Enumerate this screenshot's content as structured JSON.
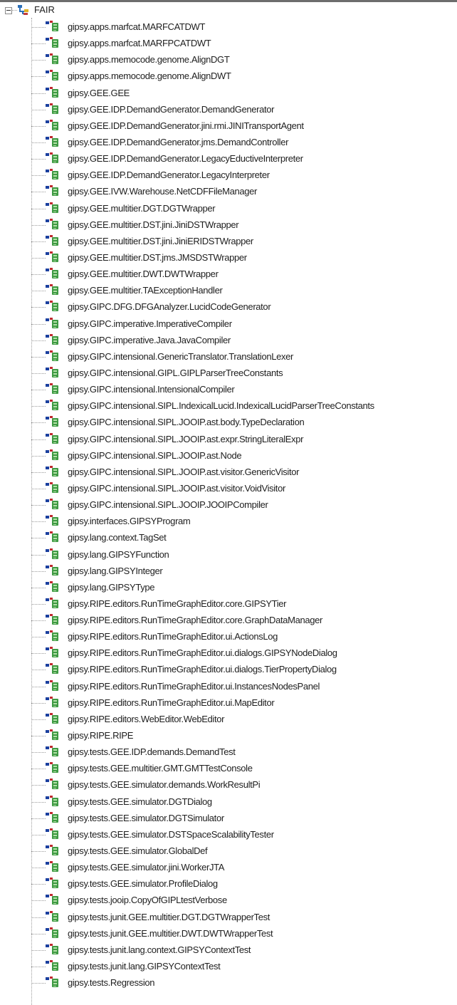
{
  "tree": {
    "root": {
      "label": "FAIR",
      "icon": "package-tree-icon",
      "expanded": true
    },
    "item_icon": "class-icon",
    "items": [
      "gipsy.apps.marfcat.MARFCATDWT",
      "gipsy.apps.marfcat.MARFPCATDWT",
      "gipsy.apps.memocode.genome.AlignDGT",
      "gipsy.apps.memocode.genome.AlignDWT",
      "gipsy.GEE.GEE",
      "gipsy.GEE.IDP.DemandGenerator.DemandGenerator",
      "gipsy.GEE.IDP.DemandGenerator.jini.rmi.JINITransportAgent",
      "gipsy.GEE.IDP.DemandGenerator.jms.DemandController",
      "gipsy.GEE.IDP.DemandGenerator.LegacyEductiveInterpreter",
      "gipsy.GEE.IDP.DemandGenerator.LegacyInterpreter",
      "gipsy.GEE.IVW.Warehouse.NetCDFFileManager",
      "gipsy.GEE.multitier.DGT.DGTWrapper",
      "gipsy.GEE.multitier.DST.jini.JiniDSTWrapper",
      "gipsy.GEE.multitier.DST.jini.JiniERIDSTWrapper",
      "gipsy.GEE.multitier.DST.jms.JMSDSTWrapper",
      "gipsy.GEE.multitier.DWT.DWTWrapper",
      "gipsy.GEE.multitier.TAExceptionHandler",
      "gipsy.GIPC.DFG.DFGAnalyzer.LucidCodeGenerator",
      "gipsy.GIPC.imperative.ImperativeCompiler",
      "gipsy.GIPC.imperative.Java.JavaCompiler",
      "gipsy.GIPC.intensional.GenericTranslator.TranslationLexer",
      "gipsy.GIPC.intensional.GIPL.GIPLParserTreeConstants",
      "gipsy.GIPC.intensional.IntensionalCompiler",
      "gipsy.GIPC.intensional.SIPL.IndexicalLucid.IndexicalLucidParserTreeConstants",
      "gipsy.GIPC.intensional.SIPL.JOOIP.ast.body.TypeDeclaration",
      "gipsy.GIPC.intensional.SIPL.JOOIP.ast.expr.StringLiteralExpr",
      "gipsy.GIPC.intensional.SIPL.JOOIP.ast.Node",
      "gipsy.GIPC.intensional.SIPL.JOOIP.ast.visitor.GenericVisitor",
      "gipsy.GIPC.intensional.SIPL.JOOIP.ast.visitor.VoidVisitor",
      "gipsy.GIPC.intensional.SIPL.JOOIP.JOOIPCompiler",
      "gipsy.interfaces.GIPSYProgram",
      "gipsy.lang.context.TagSet",
      "gipsy.lang.GIPSYFunction",
      "gipsy.lang.GIPSYInteger",
      "gipsy.lang.GIPSYType",
      "gipsy.RIPE.editors.RunTimeGraphEditor.core.GIPSYTier",
      "gipsy.RIPE.editors.RunTimeGraphEditor.core.GraphDataManager",
      "gipsy.RIPE.editors.RunTimeGraphEditor.ui.ActionsLog",
      "gipsy.RIPE.editors.RunTimeGraphEditor.ui.dialogs.GIPSYNodeDialog",
      "gipsy.RIPE.editors.RunTimeGraphEditor.ui.dialogs.TierPropertyDialog",
      "gipsy.RIPE.editors.RunTimeGraphEditor.ui.InstancesNodesPanel",
      "gipsy.RIPE.editors.RunTimeGraphEditor.ui.MapEditor",
      "gipsy.RIPE.editors.WebEditor.WebEditor",
      "gipsy.RIPE.RIPE",
      "gipsy.tests.GEE.IDP.demands.DemandTest",
      "gipsy.tests.GEE.multitier.GMT.GMTTestConsole",
      "gipsy.tests.GEE.simulator.demands.WorkResultPi",
      "gipsy.tests.GEE.simulator.DGTDialog",
      "gipsy.tests.GEE.simulator.DGTSimulator",
      "gipsy.tests.GEE.simulator.DSTSpaceScalabilityTester",
      "gipsy.tests.GEE.simulator.GlobalDef",
      "gipsy.tests.GEE.simulator.jini.WorkerJTA",
      "gipsy.tests.GEE.simulator.ProfileDialog",
      "gipsy.tests.jooip.CopyOfGIPLtestVerbose",
      "gipsy.tests.junit.GEE.multitier.DGT.DGTWrapperTest",
      "gipsy.tests.junit.GEE.multitier.DWT.DWTWrapperTest",
      "gipsy.tests.junit.lang.context.GIPSYContextTest",
      "gipsy.tests.junit.lang.GIPSYContextTest",
      "gipsy.tests.Regression"
    ]
  }
}
